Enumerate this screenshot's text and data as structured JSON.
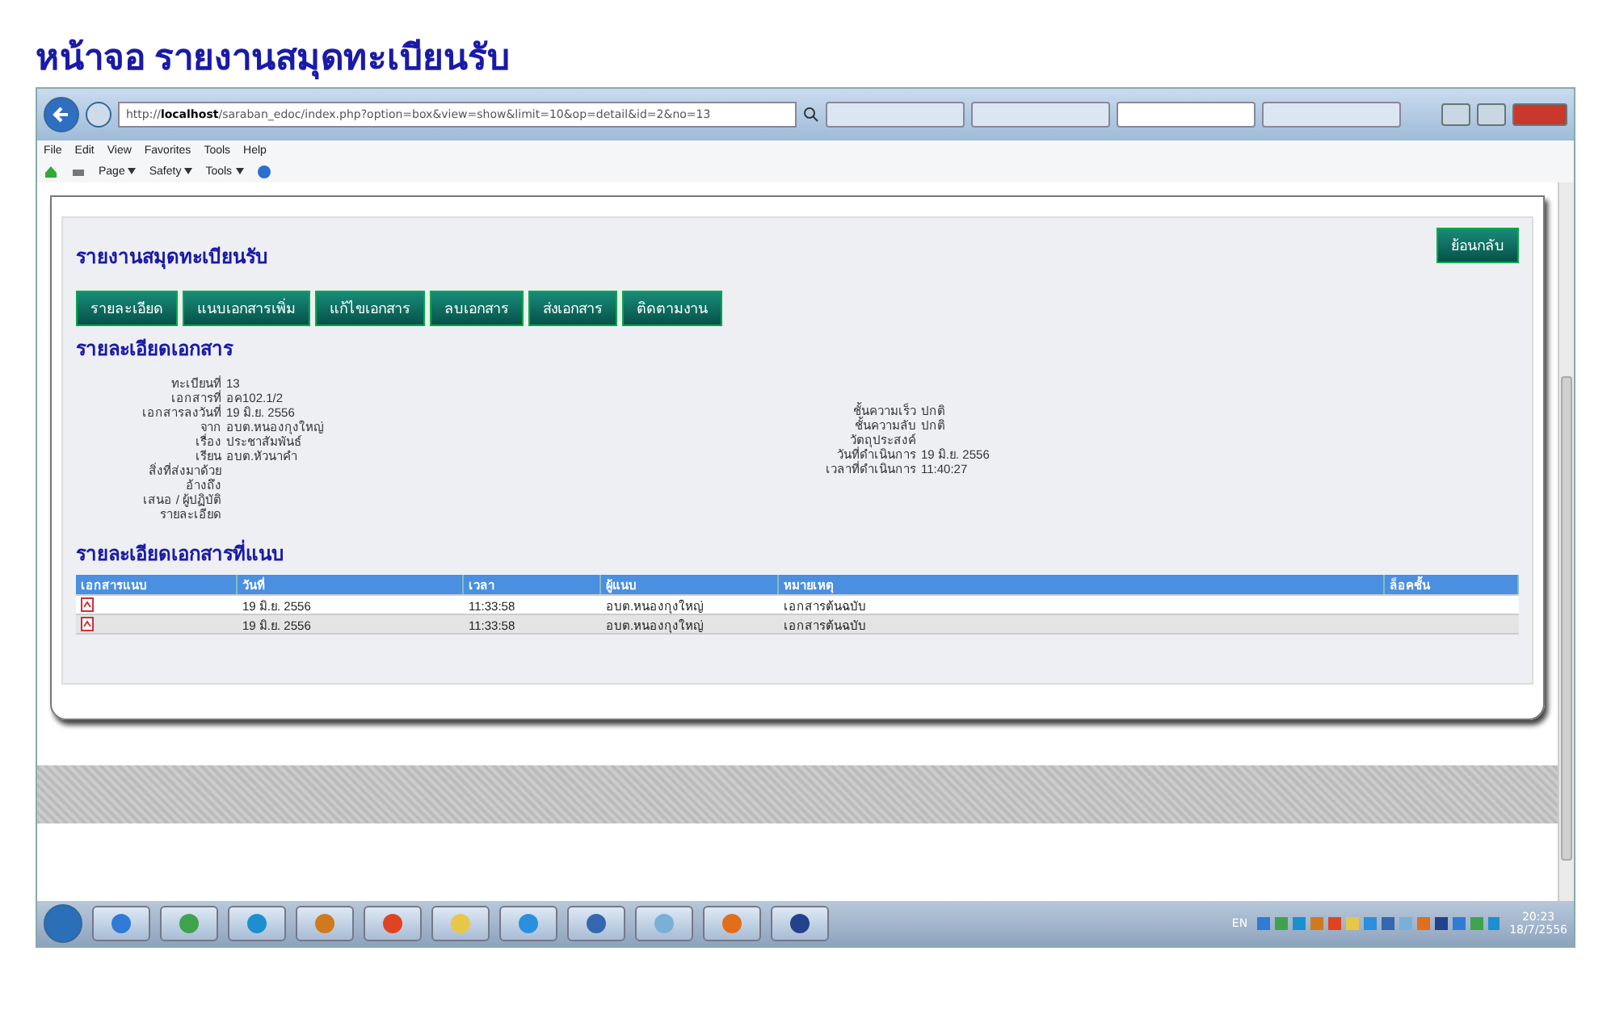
{
  "page_title": "หน้าจอ รายงานสมุดทะเบียนรับ",
  "browser": {
    "address": "http://**localhost**/saraban_edoc/index.php?option=box&view=show&limit=10&op=detail&id=2&no=13",
    "menu": [
      "File",
      "Edit",
      "View",
      "Favorites",
      "Tools",
      "Help"
    ],
    "commands": [
      "Page",
      "Safety",
      "Tools"
    ],
    "tabs": [
      {
        "selected": false
      },
      {
        "selected": false
      },
      {
        "selected": true
      },
      {
        "selected": false
      }
    ]
  },
  "report": {
    "title": "รายงานสมุดทะเบียนรับ",
    "back_button": "ย้อนกลับ",
    "actions": [
      "รายละเอียด",
      "แนบเอกสารเพิ่ม",
      "แก้ไขเอกสาร",
      "ลบเอกสาร",
      "ส่งเอกสาร",
      "ติดตามงาน"
    ],
    "details_title": "รายละเอียดเอกสาร",
    "details_left": [
      {
        "label": "ทะเบียนที่",
        "value": "13"
      },
      {
        "label": "เอกสารที่",
        "value": "อค102.1/2"
      },
      {
        "label": "เอกสารลงวันที่",
        "value": "19 มิ.ย. 2556"
      },
      {
        "label": "จาก",
        "value": "อบต.หนองกุงใหญ่"
      },
      {
        "label": "เรื่อง",
        "value": "ประชาสัมพันธ์"
      },
      {
        "label": "เรียน",
        "value": "อบต.หัวนาคำ"
      },
      {
        "label": "สิ่งที่ส่งมาด้วย"
      },
      {
        "label": "อ้างถึง"
      },
      {
        "label": "เสนอ / ผู้ปฏิบัติ"
      },
      {
        "label": "รายละเอียด"
      }
    ],
    "details_right": [
      {
        "label": "ชั้นความเร็ว",
        "value": "ปกติ"
      },
      {
        "label": "ชั้นความลับ",
        "value": "ปกติ"
      },
      {
        "label": "วัตถุประสงค์"
      },
      {
        "label": "วันที่ดำเนินการ",
        "value": "19 มิ.ย. 2556"
      },
      {
        "label": "เวลาที่ดำเนินการ",
        "value": "11:40:27"
      }
    ],
    "attachments_title": "รายละเอียดเอกสารที่แนบ",
    "table": {
      "columns": [
        "เอกสารแนบ",
        "วันที่",
        "เวลา",
        "ผู้แนบ",
        "หมายเหตุ",
        "ล็อคชั้น"
      ],
      "rows": [
        {
          "date": "19 มิ.ย. 2556",
          "time": "11:33:58",
          "by": "อบต.หนองกุงใหญ่",
          "note": "เอกสารต้นฉบับ"
        },
        {
          "date": "19 มิ.ย. 2556",
          "time": "11:33:58",
          "by": "อบต.หนองกุงใหญ่",
          "note": "เอกสารต้นฉบับ"
        }
      ]
    }
  },
  "taskbar": {
    "language": "EN",
    "clock_time": "20:23",
    "clock_date": "18/7/2556"
  }
}
